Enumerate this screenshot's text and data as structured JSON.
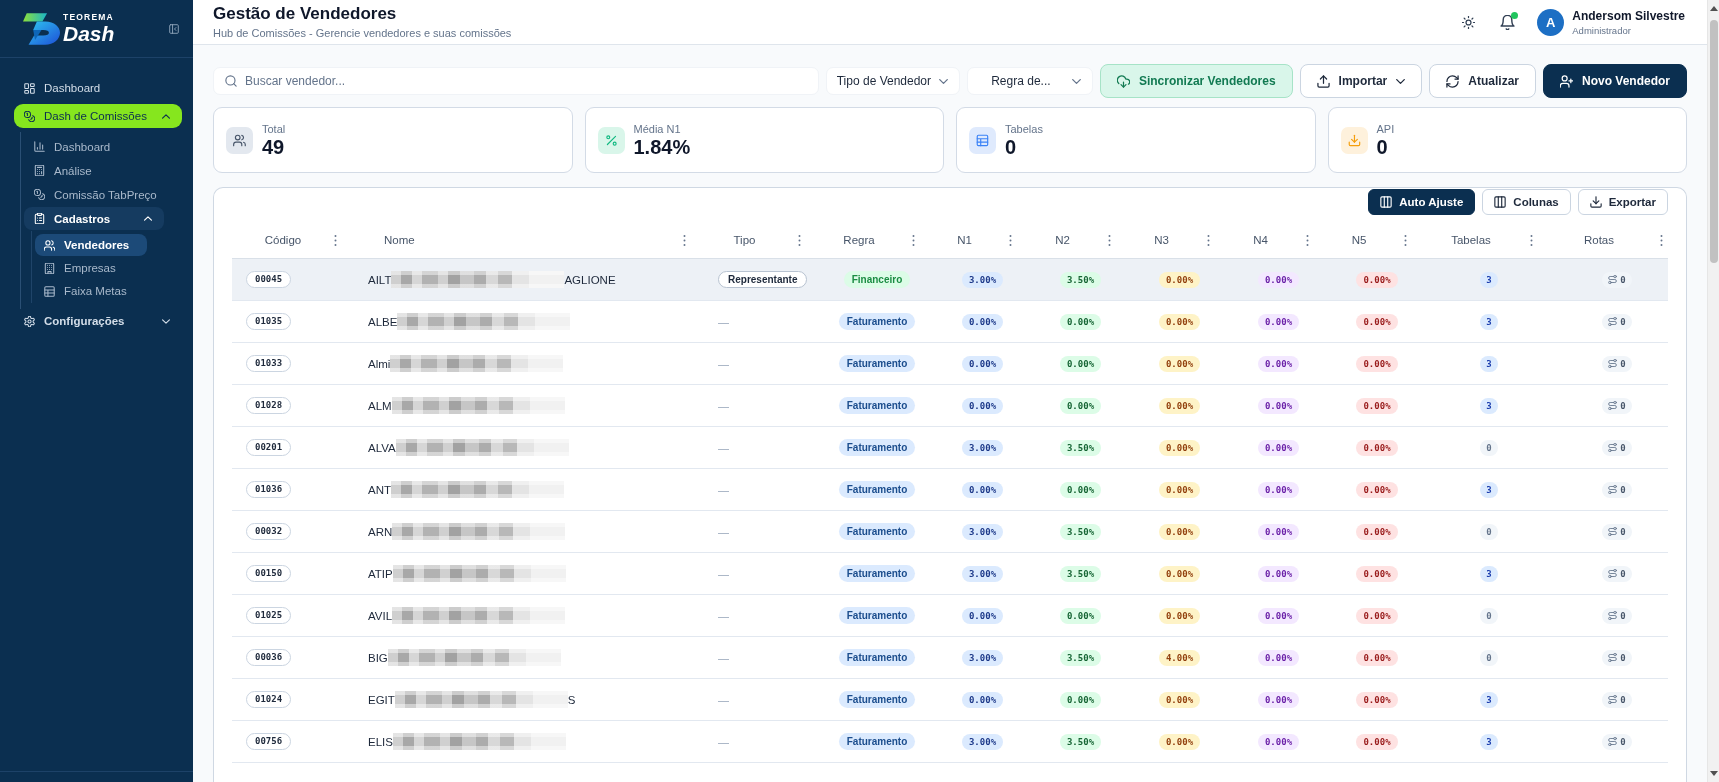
{
  "sidebar": {
    "logo": {
      "top": "TEOREMA",
      "bottom": "Dash"
    },
    "items": [
      {
        "label": "Dashboard",
        "selected": false
      },
      {
        "label": "Dash de Comissões",
        "active": true,
        "expanded": true,
        "children": [
          {
            "label": "Dashboard",
            "selected": false
          },
          {
            "label": "Análise",
            "selected": false
          },
          {
            "label": "Comissão TabPreço",
            "selected": false
          },
          {
            "label": "Cadastros",
            "active": true,
            "expanded": true,
            "children": [
              {
                "label": "Vendedores",
                "selected": true
              },
              {
                "label": "Empresas",
                "selected": false
              },
              {
                "label": "Faixa Metas",
                "selected": false
              }
            ]
          }
        ]
      },
      {
        "label": "Configurações",
        "active": false,
        "expanded": false
      }
    ]
  },
  "header": {
    "title": "Gestão de Vendedores",
    "subtitle": "Hub de Comissões - Gerencie vendedores e suas comissões",
    "notifications": {
      "unread": true
    },
    "user": {
      "initial": "A",
      "name": "Andersom Silvestre",
      "role": "Administrador"
    }
  },
  "toolbar": {
    "search": {
      "placeholder": "Buscar vendedor..."
    },
    "filters": [
      {
        "value": "Tipo de Vendedor"
      },
      {
        "value": "Regra de..."
      }
    ],
    "buttons": [
      {
        "label": "Sincronizar Vendedores",
        "kind": "success"
      },
      {
        "label": "Importar",
        "kind": "menu"
      },
      {
        "label": "Atualizar",
        "kind": "outline"
      },
      {
        "label": "Novo Vendedor",
        "kind": "primary"
      }
    ]
  },
  "stats": [
    {
      "label": "Total",
      "value": "49"
    },
    {
      "label": "Média N1",
      "value": "1.84%"
    },
    {
      "label": "Tabelas",
      "value": "0"
    },
    {
      "label": "API",
      "value": "0"
    }
  ],
  "table": {
    "actions": [
      {
        "label": "Auto Ajuste",
        "kind": "primary"
      },
      {
        "label": "Colunas",
        "kind": "outline"
      },
      {
        "label": "Exportar",
        "kind": "outline"
      }
    ],
    "columns": [
      "Código",
      "Nome",
      "Tipo",
      "Regra",
      "N1",
      "N2",
      "N3",
      "N4",
      "N5",
      "Tabelas",
      "Rotas"
    ],
    "rows": [
      {
        "code": "00045",
        "name": "AILT",
        "name_end": "AGLIONE",
        "type": {
          "label": "Representante",
          "kind": "tag"
        },
        "rule": {
          "label": "Financeiro",
          "color": "#dcfce7"
        },
        "rates": [
          "3.00%",
          "3.50%",
          "0.00%",
          "0.00%",
          "0.00%"
        ],
        "tables": {
          "count": "3",
          "active": true
        },
        "routes": "0",
        "selected": true
      },
      {
        "code": "01035",
        "name": "ALBE",
        "type": {
          "label": "—",
          "kind": "empty"
        },
        "rule": {
          "label": "Faturamento",
          "color": "#dbeafe"
        },
        "rates": [
          "0.00%",
          "0.00%",
          "0.00%",
          "0.00%",
          "0.00%"
        ],
        "tables": {
          "count": "3",
          "active": true
        },
        "routes": "0",
        "selected": false
      },
      {
        "code": "01033",
        "name": "Almi",
        "type": {
          "label": "—",
          "kind": "empty"
        },
        "rule": {
          "label": "Faturamento",
          "color": "#dbeafe"
        },
        "rates": [
          "0.00%",
          "0.00%",
          "0.00%",
          "0.00%",
          "0.00%"
        ],
        "tables": {
          "count": "3",
          "active": true
        },
        "routes": "0",
        "selected": false
      },
      {
        "code": "01028",
        "name": "ALM",
        "type": {
          "label": "—",
          "kind": "empty"
        },
        "rule": {
          "label": "Faturamento",
          "color": "#dbeafe"
        },
        "rates": [
          "0.00%",
          "0.00%",
          "0.00%",
          "0.00%",
          "0.00%"
        ],
        "tables": {
          "count": "3",
          "active": true
        },
        "routes": "0",
        "selected": false
      },
      {
        "code": "00201",
        "name": "ALVA",
        "type": {
          "label": "—",
          "kind": "empty"
        },
        "rule": {
          "label": "Faturamento",
          "color": "#dbeafe"
        },
        "rates": [
          "3.00%",
          "3.50%",
          "0.00%",
          "0.00%",
          "0.00%"
        ],
        "tables": {
          "count": "0",
          "active": false
        },
        "routes": "0",
        "selected": false
      },
      {
        "code": "01036",
        "name": "ANT",
        "type": {
          "label": "—",
          "kind": "empty"
        },
        "rule": {
          "label": "Faturamento",
          "color": "#dbeafe"
        },
        "rates": [
          "0.00%",
          "0.00%",
          "0.00%",
          "0.00%",
          "0.00%"
        ],
        "tables": {
          "count": "3",
          "active": true
        },
        "routes": "0",
        "selected": false
      },
      {
        "code": "00032",
        "name": "ARN",
        "type": {
          "label": "—",
          "kind": "empty"
        },
        "rule": {
          "label": "Faturamento",
          "color": "#dbeafe"
        },
        "rates": [
          "3.00%",
          "3.50%",
          "0.00%",
          "0.00%",
          "0.00%"
        ],
        "tables": {
          "count": "0",
          "active": false
        },
        "routes": "0",
        "selected": false
      },
      {
        "code": "00150",
        "name": "ATIP",
        "type": {
          "label": "—",
          "kind": "empty"
        },
        "rule": {
          "label": "Faturamento",
          "color": "#dbeafe"
        },
        "rates": [
          "3.00%",
          "3.50%",
          "0.00%",
          "0.00%",
          "0.00%"
        ],
        "tables": {
          "count": "3",
          "active": true
        },
        "routes": "0",
        "selected": false
      },
      {
        "code": "01025",
        "name": "AVIL",
        "type": {
          "label": "—",
          "kind": "empty"
        },
        "rule": {
          "label": "Faturamento",
          "color": "#dbeafe"
        },
        "rates": [
          "0.00%",
          "0.00%",
          "0.00%",
          "0.00%",
          "0.00%"
        ],
        "tables": {
          "count": "0",
          "active": false
        },
        "routes": "0",
        "selected": false
      },
      {
        "code": "00036",
        "name": "BIG",
        "type": {
          "label": "—",
          "kind": "empty"
        },
        "rule": {
          "label": "Faturamento",
          "color": "#dbeafe"
        },
        "rates": [
          "3.00%",
          "3.50%",
          "4.00%",
          "0.00%",
          "0.00%"
        ],
        "tables": {
          "count": "0",
          "active": false
        },
        "routes": "0",
        "selected": false
      },
      {
        "code": "01024",
        "name": "EGIT",
        "name_end": "S",
        "type": {
          "label": "—",
          "kind": "empty"
        },
        "rule": {
          "label": "Faturamento",
          "color": "#dbeafe"
        },
        "rates": [
          "0.00%",
          "0.00%",
          "0.00%",
          "0.00%",
          "0.00%"
        ],
        "tables": {
          "count": "3",
          "active": true
        },
        "routes": "0",
        "selected": false
      },
      {
        "code": "00756",
        "name": "ELIS",
        "type": {
          "label": "—",
          "kind": "empty"
        },
        "rule": {
          "label": "Faturamento",
          "color": "#dbeafe"
        },
        "rates": [
          "3.00%",
          "3.50%",
          "0.00%",
          "0.00%",
          "0.00%"
        ],
        "tables": {
          "count": "3",
          "active": true
        },
        "routes": "0",
        "selected": false
      }
    ]
  }
}
